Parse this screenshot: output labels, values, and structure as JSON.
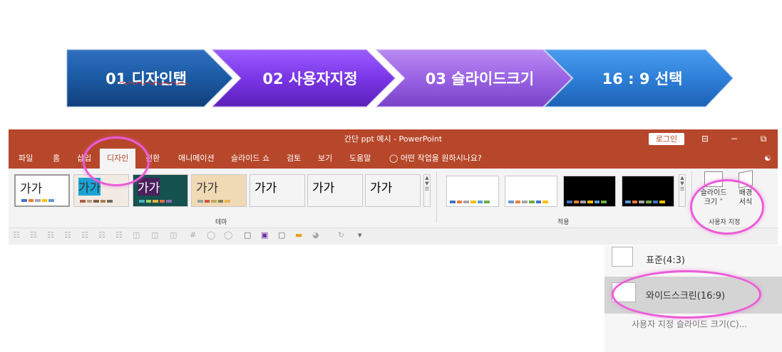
{
  "steps": [
    {
      "label": "01 디자인탭"
    },
    {
      "label": "02 사용자지정"
    },
    {
      "label": "03 슬라이드크기"
    },
    {
      "label": "16 : 9 선택"
    }
  ],
  "window": {
    "title": "간단 ppt 예시  -  PowerPoint",
    "login_label": "로그인",
    "minimize_label": "−",
    "restore_label": "⧉",
    "ribbon_display_label": "⊟"
  },
  "tabs": [
    {
      "label": "파일"
    },
    {
      "label": "홈"
    },
    {
      "label": "삽입"
    },
    {
      "label": "디자인"
    },
    {
      "label": "전환"
    },
    {
      "label": "애니메이션"
    },
    {
      "label": "슬라이드 쇼"
    },
    {
      "label": "검토"
    },
    {
      "label": "보기"
    },
    {
      "label": "도움말"
    }
  ],
  "tell_me": {
    "placeholder": "어떤 작업을 원하시나요?",
    "icon": "lightbulb-icon"
  },
  "ribbon": {
    "themes_group_label": "테마",
    "variants_group_label": "적용",
    "customize_group_label": "사용자 지정",
    "theme_text": "가가",
    "themes": [
      {
        "bg": "#ffffff",
        "fg": "#222222",
        "dots": [
          "#4472c4",
          "#ed7d31",
          "#a5a5a5",
          "#ffc000",
          "#5b9bd5"
        ]
      },
      {
        "bg": "#ffffff",
        "fg": "#222222",
        "dots": [
          "#4472c4",
          "#ed7d31",
          "#a5a5a5",
          "#ffc000",
          "#5b9bd5"
        ]
      },
      {
        "bg": "#f2ebe4",
        "fg": "#333333",
        "dots": [
          "#a5644e",
          "#b19c7d",
          "#7f5f52",
          "#b27d49",
          "#6e6b62"
        ]
      },
      {
        "bg": "#1aa3d4",
        "fg": "#ffffff",
        "dots": [
          "#31b6fd",
          "#4584d3",
          "#5bd078",
          "#a5d028",
          "#f5c040"
        ]
      },
      {
        "bg": "#16524f",
        "fg": "#ffffff",
        "dots": [
          "#4ab5c4",
          "#9fd26b",
          "#e3b53a",
          "#e76a4a",
          "#8d6cab"
        ]
      },
      {
        "bg": "#4b1f5c",
        "fg": "#ffffff",
        "dots": [
          "#e2a23b",
          "#a3c636",
          "#6e9bc6",
          "#c45f98",
          "#ffffff"
        ]
      },
      {
        "bg": "#f0d9b5",
        "fg": "#333333",
        "dots": [
          "#93a299",
          "#cf543f",
          "#b5ae53",
          "#848058",
          "#e8b54d"
        ]
      }
    ],
    "variants": [
      {
        "bg": "#ffffff",
        "dots": [
          "#4472c4",
          "#ed7d31",
          "#a5a5a5",
          "#ffc000",
          "#5b9bd5",
          "#70ad47"
        ]
      },
      {
        "bg": "#ffffff",
        "dots": [
          "#5b9bd5",
          "#ed7d31",
          "#a5a5a5",
          "#70ad47",
          "#4472c4",
          "#ffc000"
        ]
      },
      {
        "bg": "#000000",
        "dots": [
          "#4472c4",
          "#ed7d31",
          "#a5a5a5",
          "#ffc000",
          "#5b9bd5",
          "#70ad47"
        ]
      },
      {
        "bg": "#000000",
        "dots": [
          "#5b9bd5",
          "#ed7d31",
          "#a5a5a5",
          "#70ad47",
          "#4472c4",
          "#ffc000"
        ]
      }
    ],
    "slide_size_label_1": "슬라이드",
    "slide_size_label_2": "크기 ˅",
    "format_bg_label_1": "배경",
    "format_bg_label_2": "서식"
  },
  "dropdown": {
    "standard_label": "표준(4:3)",
    "widescreen_label": "와이드스크린(16:9)",
    "custom_label": "사용자 지정 슬라이드 크기(C)..."
  },
  "colors": {
    "ppt_red": "#b7472a",
    "step1": "#1b5aa3",
    "step2": "#7a36e6",
    "step3": "#9a63e4",
    "step4": "#2e7fd8",
    "highlight": "#ec5bd8"
  }
}
